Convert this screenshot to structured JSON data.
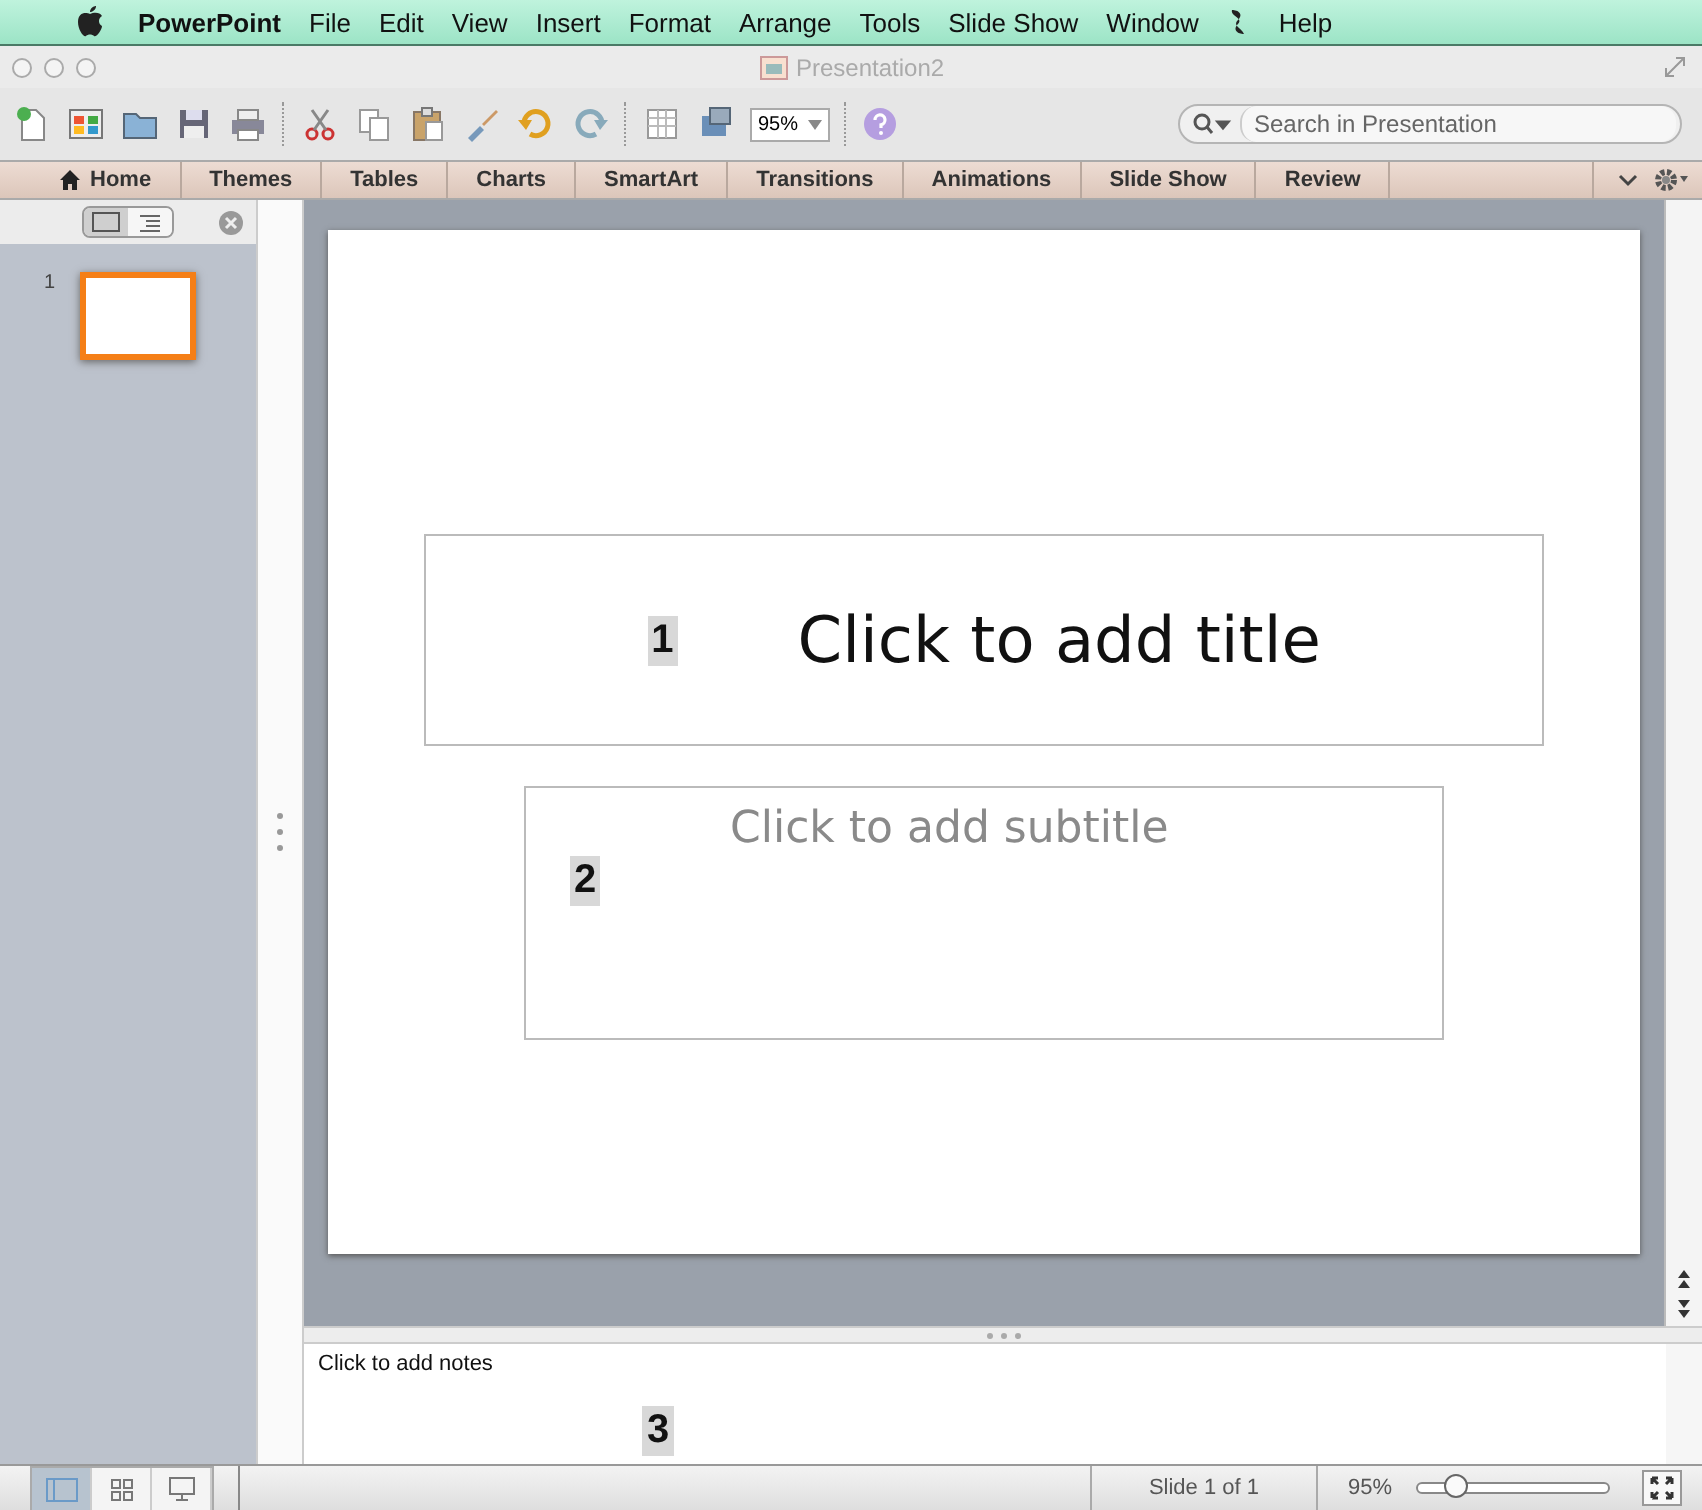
{
  "menu_bar": {
    "app_name": "PowerPoint",
    "items": [
      "File",
      "Edit",
      "View",
      "Insert",
      "Format",
      "Arrange",
      "Tools",
      "Slide Show",
      "Window",
      "Help"
    ]
  },
  "window": {
    "title": "Presentation2"
  },
  "toolbar": {
    "zoom": "95%",
    "search": {
      "placeholder": "Search in Presentation"
    }
  },
  "ribbon_tabs": [
    "Home",
    "Themes",
    "Tables",
    "Charts",
    "SmartArt",
    "Transitions",
    "Animations",
    "Slide Show",
    "Review"
  ],
  "slide_pane": {
    "view_toggle": [
      {
        "kind": "slides",
        "selected": true
      },
      {
        "kind": "outline",
        "selected": false
      }
    ],
    "slides": [
      {
        "number": "1",
        "selected": true
      }
    ]
  },
  "slide": {
    "title_placeholder": "Click to add title",
    "subtitle_placeholder": "Click to add subtitle"
  },
  "notes": {
    "placeholder": "Click to add notes"
  },
  "callouts": [
    "1",
    "2",
    "3"
  ],
  "status_bar": {
    "views": [
      {
        "kind": "normal",
        "selected": true
      },
      {
        "kind": "sorter",
        "selected": false
      },
      {
        "kind": "show",
        "selected": false
      }
    ],
    "slide_info": "Slide 1 of 1",
    "zoom": "95%",
    "zoom_level": {
      "level": 0.2
    }
  }
}
